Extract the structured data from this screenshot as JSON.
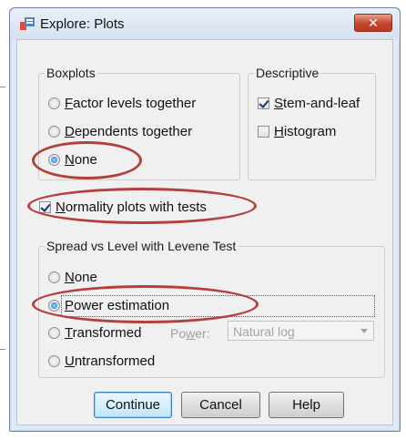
{
  "window": {
    "title": "Explore: Plots",
    "close_glyph": "✕"
  },
  "boxplots": {
    "legend": "Boxplots",
    "options": [
      {
        "pre": "",
        "key": "F",
        "post": "actor levels together",
        "checked": false
      },
      {
        "pre": "",
        "key": "D",
        "post": "ependents together",
        "checked": false
      },
      {
        "pre": "",
        "key": "N",
        "post": "one",
        "checked": true
      }
    ]
  },
  "descriptive": {
    "legend": "Descriptive",
    "options": [
      {
        "pre": "",
        "key": "S",
        "post": "tem-and-leaf",
        "checked": true
      },
      {
        "pre": "",
        "key": "H",
        "post": "istogram",
        "checked": false
      }
    ]
  },
  "normality": {
    "pre": "",
    "key": "N",
    "post": "ormality plots with tests",
    "checked": true
  },
  "spread": {
    "legend": "Spread vs Level with Levene Test",
    "options": [
      {
        "pre": "",
        "key": "N",
        "post": "one",
        "checked": false
      },
      {
        "pre": "",
        "key": "P",
        "post": "ower estimation",
        "checked": true
      },
      {
        "pre": "",
        "key": "T",
        "post": "ransformed",
        "checked": false
      },
      {
        "pre": "",
        "key": "U",
        "post": "ntransformed",
        "checked": false
      }
    ],
    "power_label_pre": "Po",
    "power_label_key": "w",
    "power_label_post": "er:",
    "power_value": "Natural log"
  },
  "buttons": {
    "continue": "Continue",
    "cancel": "Cancel",
    "help": "Help"
  },
  "colors": {
    "annotation": "#b3403c",
    "titlebar": "#dfe9f5",
    "close": "#c6442c"
  }
}
